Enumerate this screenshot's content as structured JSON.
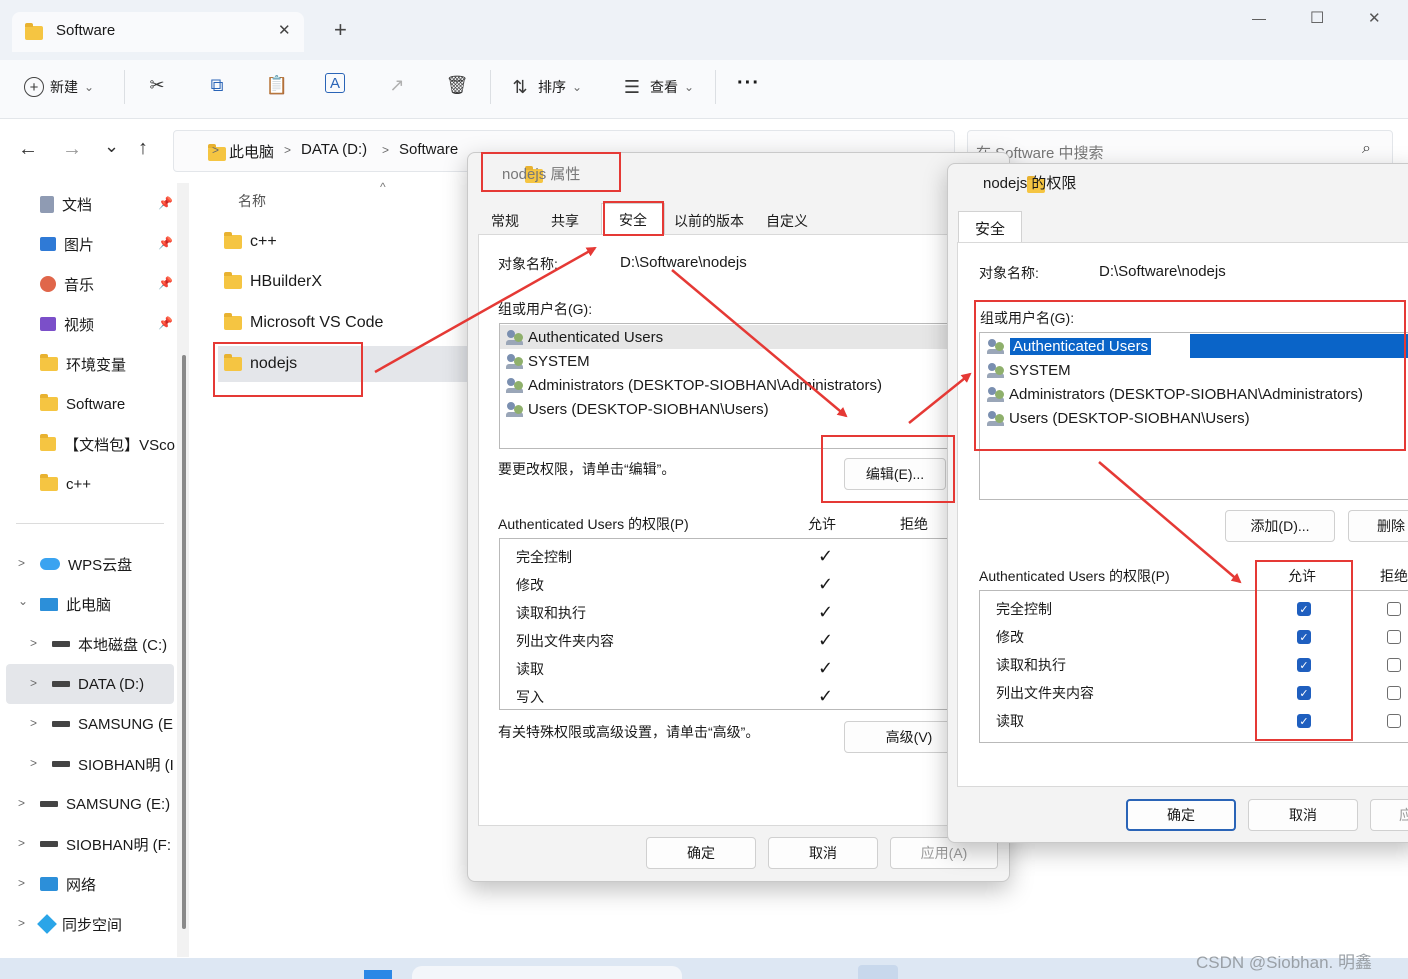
{
  "window": {
    "tab_title": "Software",
    "tab_close": "✕",
    "new_tab": "+",
    "minimize": "—",
    "maximize": "☐",
    "close": "✕"
  },
  "toolbar": {
    "new_label": "新建",
    "sort_label": "排序",
    "view_label": "查看",
    "more_label": "···"
  },
  "nav": {
    "back": "←",
    "forward": "→",
    "history": "⌄",
    "up": "↑"
  },
  "address": {
    "crumbs": [
      "此电脑",
      "DATA (D:)",
      "Software"
    ],
    "separator": ">"
  },
  "search": {
    "placeholder": "在 Software 中搜索"
  },
  "sidebar": {
    "quick": [
      {
        "label": "文档",
        "icon": "document-icon",
        "pinned": true
      },
      {
        "label": "图片",
        "icon": "pictures-icon",
        "pinned": true
      },
      {
        "label": "音乐",
        "icon": "music-icon",
        "pinned": true
      },
      {
        "label": "视频",
        "icon": "video-icon",
        "pinned": true
      },
      {
        "label": "环境变量",
        "icon": "folder-icon"
      },
      {
        "label": "Software",
        "icon": "folder-icon"
      },
      {
        "label": "【文档包】VSco",
        "icon": "folder-icon"
      },
      {
        "label": "c++",
        "icon": "folder-icon"
      }
    ],
    "tree": [
      {
        "label": "WPS云盘",
        "icon": "cloud-icon",
        "chev": ">"
      },
      {
        "label": "此电脑",
        "icon": "pc-icon",
        "chev": "⌄"
      },
      {
        "label": "本地磁盘 (C:)",
        "icon": "drive-icon",
        "chev": ">"
      },
      {
        "label": "DATA (D:)",
        "icon": "drive-icon",
        "chev": ">",
        "selected": true
      },
      {
        "label": "SAMSUNG (E",
        "icon": "drive-icon",
        "chev": ">"
      },
      {
        "label": "SIOBHAN明 (I",
        "icon": "drive-icon",
        "chev": ">"
      },
      {
        "label": "SAMSUNG (E:)",
        "icon": "drive-icon",
        "chev": ">"
      },
      {
        "label": "SIOBHAN明 (F:",
        "icon": "drive-icon",
        "chev": ">"
      },
      {
        "label": "网络",
        "icon": "network-icon",
        "chev": ">"
      },
      {
        "label": "同步空间",
        "icon": "sync-icon",
        "chev": ">"
      }
    ]
  },
  "files": {
    "column_name": "名称",
    "items": [
      "c++",
      "HBuilderX",
      "Microsoft VS Code",
      "nodejs"
    ]
  },
  "props": {
    "title": "nodejs 属性",
    "tabs": [
      "常规",
      "共享",
      "安全",
      "以前的版本",
      "自定义"
    ],
    "object_label": "对象名称:",
    "object_value": "D:\\Software\\nodejs",
    "group_label": "组或用户名(G):",
    "users": [
      "Authenticated Users",
      "SYSTEM",
      "Administrators (DESKTOP-SIOBHAN\\Administrators)",
      "Users (DESKTOP-SIOBHAN\\Users)"
    ],
    "edit_hint": "要更改权限，请单击“编辑”。",
    "edit_button": "编辑(E)...",
    "perm_label": "Authenticated Users 的权限(P)",
    "allow": "允许",
    "deny": "拒绝",
    "perms": [
      "完全控制",
      "修改",
      "读取和执行",
      "列出文件夹内容",
      "读取",
      "写入"
    ],
    "check": "✓",
    "adv_hint": "有关特殊权限或高级设置，请单击“高级”。",
    "adv_button": "高级(V)",
    "ok": "确定",
    "cancel": "取消",
    "apply": "应用(A)"
  },
  "perm_dialog": {
    "title": "nodejs 的权限",
    "tab": "安全",
    "object_label": "对象名称:",
    "object_value": "D:\\Software\\nodejs",
    "group_label": "组或用户名(G):",
    "users": [
      "Authenticated Users",
      "SYSTEM",
      "Administrators (DESKTOP-SIOBHAN\\Administrators)",
      "Users (DESKTOP-SIOBHAN\\Users)"
    ],
    "add_button": "添加(D)...",
    "remove_button": "删除",
    "perm_label": "Authenticated Users 的权限(P)",
    "allow": "允许",
    "deny": "拒绝",
    "perms": [
      "完全控制",
      "修改",
      "读取和执行",
      "列出文件夹内容",
      "读取"
    ],
    "ok": "确定",
    "cancel": "取消",
    "apply_partial": "应"
  },
  "watermark": "CSDN @Siobhan. 明鑫",
  "colors": {
    "annotation": "#e53935",
    "selection": "#0a64c8",
    "accent": "#1f5fbf"
  }
}
